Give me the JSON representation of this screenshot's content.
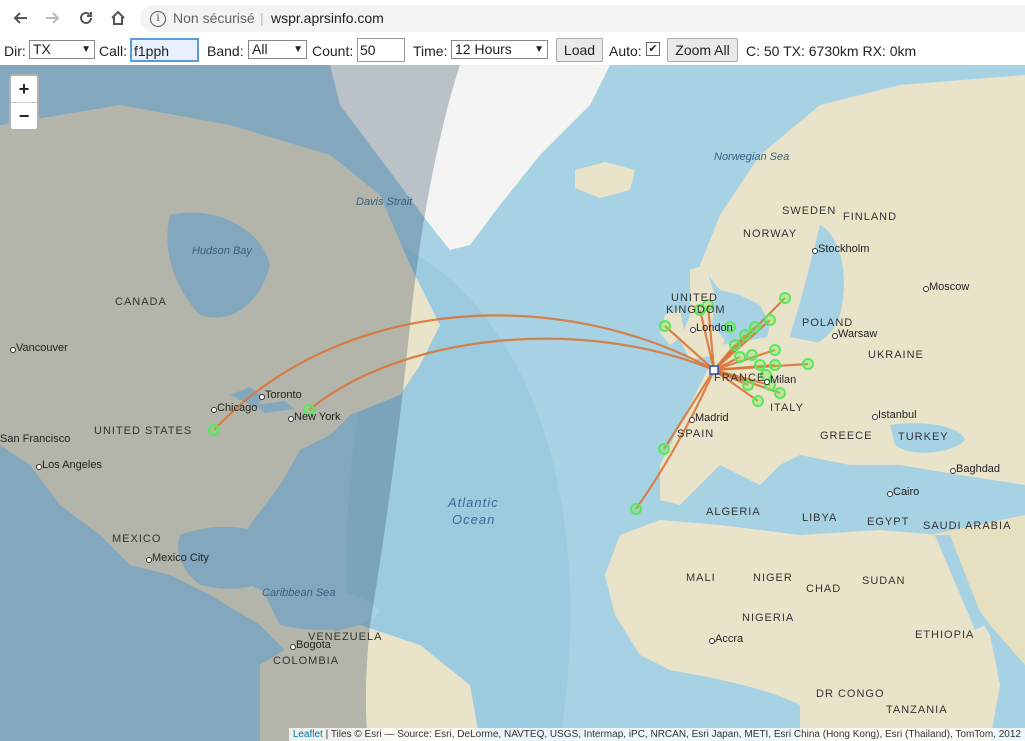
{
  "browser": {
    "security_label": "Non sécurisé",
    "url": "wspr.aprsinfo.com"
  },
  "controls": {
    "dir_label": "Dir:",
    "dir_value": "TX",
    "call_label": "Call:",
    "call_value": "f1pph",
    "band_label": "Band:",
    "band_value": "All",
    "count_label": "Count:",
    "count_value": "50",
    "time_label": "Time:",
    "time_value": "12 Hours",
    "load_button": "Load",
    "auto_label": "Auto:",
    "auto_checked": true,
    "zoom_all_button": "Zoom All",
    "stats": "C: 50 TX: 6730km RX: 0km"
  },
  "map": {
    "zoom_in": "+",
    "zoom_out": "−",
    "labels": {
      "norwegian_sea": "Norwegian Sea",
      "davis_strait": "Davis Strait",
      "hudson_bay": "Hudson Bay",
      "canada": "CANADA",
      "vancouver": "Vancouver",
      "chicago": "Chicago",
      "toronto": "Toronto",
      "new_york": "New York",
      "united_states": "UNITED STATES",
      "san_francisco": "San Francisco",
      "los_angeles": "Los Angeles",
      "mexico": "MEXICO",
      "mexico_city": "Mexico City",
      "caribbean_sea": "Caribbean Sea",
      "venezuela": "VENEZUELA",
      "bogota": "Bogota",
      "colombia": "COLOMBIA",
      "atlantic_ocean_1": "Atlantic",
      "atlantic_ocean_2": "Ocean",
      "sweden": "SWEDEN",
      "finland": "FINLAND",
      "norway": "NORWAY",
      "stockholm": "Stockholm",
      "moscow": "Moscow",
      "united_kingdom_1": "UNITED",
      "united_kingdom_2": "KINGDOM",
      "london": "London",
      "poland": "POLAND",
      "warsaw": "Warsaw",
      "ukraine": "UKRAINE",
      "france": "FRANCE",
      "milan": "Milan",
      "italy": "ITALY",
      "madrid": "Madrid",
      "spain": "SPAIN",
      "istanbul": "Istanbul",
      "greece": "GREECE",
      "turkey": "TURKEY",
      "baghdad": "Baghdad",
      "cairo": "Cairo",
      "algeria": "ALGERIA",
      "libya": "LIBYA",
      "egypt": "EGYPT",
      "saudi_arabia": "SAUDI ARABIA",
      "mali": "MALI",
      "niger": "NIGER",
      "chad": "CHAD",
      "sudan": "SUDAN",
      "nigeria": "NIGERIA",
      "ethiopia": "ETHIOPIA",
      "accra": "Accra",
      "dr_congo": "DR CONGO",
      "tanzania": "TANZANIA"
    },
    "attribution_link": "Leaflet",
    "attribution_text": " | Tiles © Esri — Source: Esri, DeLorme, NAVTEQ, USGS, Intermap, iPC, NRCAN, Esri Japan, METI, Esri China (Hong Kong), Esri (Thailand), TomTom, 2012",
    "colors": {
      "path": "#d9763b",
      "spot": "#5ce65c",
      "ocean": "#a7d2e4",
      "land": "#eae6cf",
      "night": "rgba(40,60,90,0.28)"
    }
  }
}
